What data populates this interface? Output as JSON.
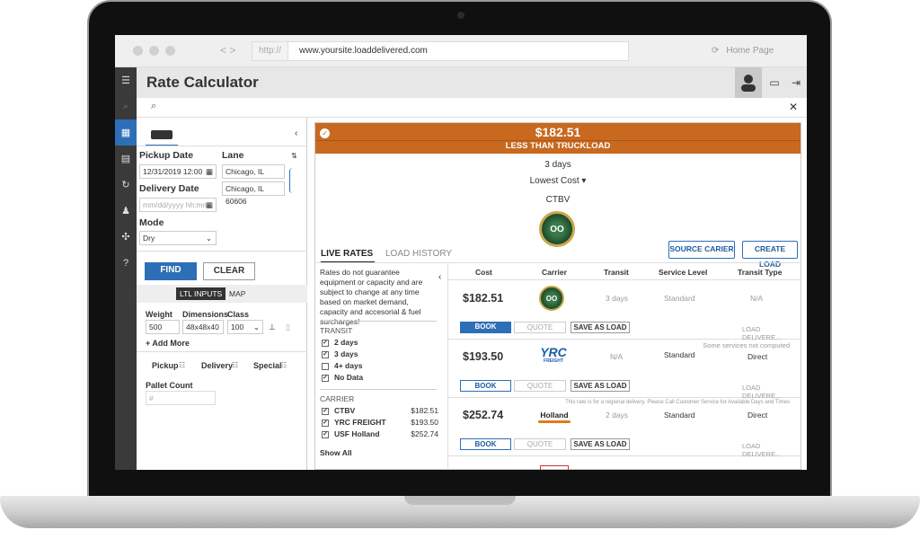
{
  "browser": {
    "proto": "http://",
    "url": "www.yoursite.loaddelivered.com",
    "home": "Home Page",
    "back": "< >"
  },
  "app": {
    "title": "Rate Calculator"
  },
  "left": {
    "pickup_label": "Pickup Date",
    "pickup_value": "12/31/2019 12:00",
    "lane_label": "Lane",
    "lane_from": "Chicago, IL 60606",
    "lane_to": "Chicago, IL 60606",
    "delivery_label": "Delivery Date",
    "delivery_placeholder": "mm/dd/yyyy hh:mm",
    "mode_label": "Mode",
    "mode_value": "Dry",
    "find": "FIND",
    "clear": "CLEAR",
    "tab_inputs": "LTL INPUTS",
    "tab_map": "MAP",
    "weight_label": "Weight",
    "weight_value": "500",
    "dims_label": "Dimensions",
    "dims_value": "48x48x40",
    "class_label": "Class",
    "class_value": "100",
    "add_more": "+ Add More",
    "pickup_tab": "Pickup",
    "delivery_tab": "Delivery",
    "special_tab": "Special",
    "pallet_label": "Pallet Count",
    "pallet_placeholder": "#"
  },
  "banner": {
    "price": "$182.51",
    "subtitle": "LESS THAN TRUCKLOAD"
  },
  "summary": {
    "days": "3 days",
    "sort": "Lowest Cost ▾",
    "carrier": "CTBV"
  },
  "tabs": {
    "live": "LIVE RATES",
    "history": "LOAD HISTORY"
  },
  "buttons": {
    "source": "SOURCE CARIER",
    "create": "CREATE LOAD"
  },
  "filter": {
    "note": "Rates do not guarantee equipment or capacity and are subject to change at any time based on market demand, capacity and accesorial & fuel surcharges!",
    "transit_title": "TRANSIT",
    "transit": [
      {
        "label": "2 days",
        "checked": "✓"
      },
      {
        "label": "3 days",
        "checked": "✓"
      },
      {
        "label": "4+ days",
        "checked": ""
      },
      {
        "label": "No Data",
        "checked": "✓"
      }
    ],
    "carrier_title": "CARRIER",
    "carriers": [
      {
        "label": "CTBV",
        "price": "$182.51"
      },
      {
        "label": "YRC FREIGHT",
        "price": "$193.50"
      },
      {
        "label": "USF Holland",
        "price": "$252.74"
      }
    ],
    "show_all": "Show All"
  },
  "table": {
    "headers": [
      "Cost",
      "Carrier",
      "Transit",
      "Service Level",
      "Transit Type"
    ],
    "rows": [
      {
        "cost": "$182.51",
        "carrier": "CTBV",
        "transit": "3 days",
        "service": "Standard",
        "type": "N/A",
        "note": "",
        "ld": "LOAD DELIVERE..."
      },
      {
        "cost": "$193.50",
        "carrier": "YRC",
        "carrier_sub": "FREIGHT",
        "transit": "N/A",
        "service": "Standard",
        "type": "Direct",
        "note": "Some services not computed",
        "ld": "LOAD DELIVERE..."
      },
      {
        "cost": "$252.74",
        "carrier": "Holland",
        "transit": "2 days",
        "service": "Standard",
        "type": "Direct",
        "note": "This rate is for a regional delivery. Please Call Customer Service for Available Days and Times",
        "ld": "LOAD DELIVERE..."
      }
    ],
    "book": "BOOK",
    "quote": "QUOTE",
    "save": "SAVE AS LOAD"
  }
}
